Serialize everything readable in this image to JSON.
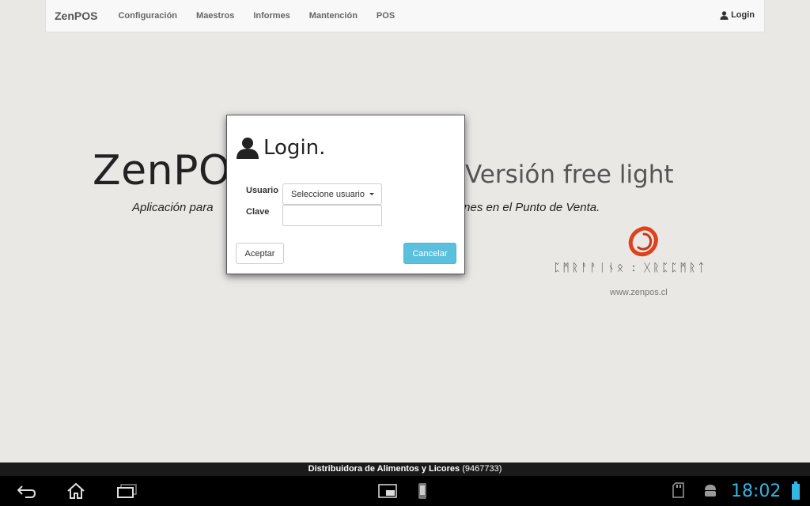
{
  "navbar": {
    "brand": "ZenPOS",
    "items": [
      {
        "label": "Configuración"
      },
      {
        "label": "Maestros"
      },
      {
        "label": "Informes"
      },
      {
        "label": "Mantención"
      },
      {
        "label": "POS"
      }
    ],
    "login_label": "Login",
    "login_icon": "user-icon"
  },
  "hero": {
    "title_left": "ZenPOS",
    "title_right": "Versión free light",
    "subtitle_left": "Aplicación para",
    "subtitle_right": "ciones en el Punto de Venta.",
    "runes": "ᛈᛗᚱᚨᚨᛁᚾᛟ : ᚷᚱᛈᛈᛗᚱᛏ",
    "website": "www.zenpos.cl",
    "logo_color": "#e0401c"
  },
  "modal": {
    "title": "Login.",
    "title_icon": "user-icon",
    "user_label": "Usuario",
    "user_select": "Seleccione usuario",
    "password_label": "Clave",
    "password_value": "",
    "accept_label": "Aceptar",
    "cancel_label": "Cancelar",
    "cancel_color": "#5bc0de"
  },
  "status": {
    "company": "Distribuidora de Alimentos y Licores",
    "code": "(9467733)"
  },
  "system_bar": {
    "clock": "18:02",
    "icons": [
      "back-icon",
      "home-icon",
      "recent-apps-icon",
      "screenshot-icon",
      "phone-icon",
      "sd-card-icon",
      "android-icon",
      "battery-icon"
    ]
  }
}
